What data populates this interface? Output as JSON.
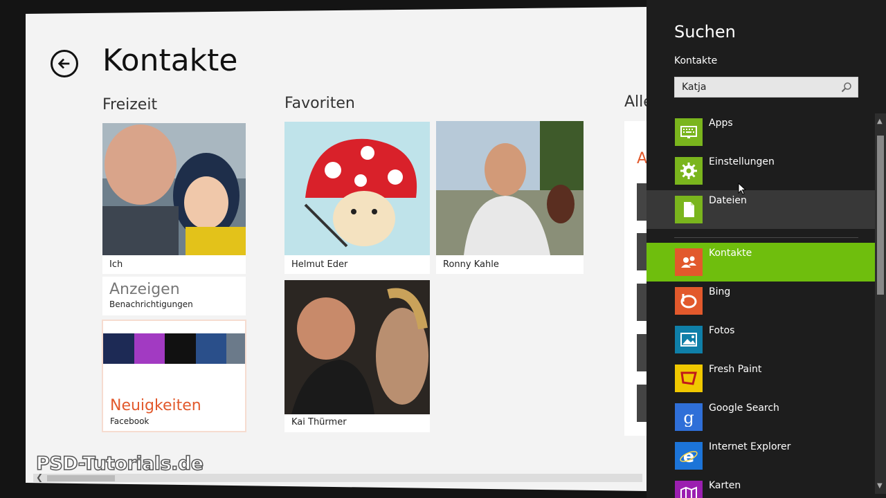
{
  "app": {
    "title": "Kontakte",
    "groups": {
      "freizeit": "Freizeit",
      "favoriten": "Favoriten",
      "alle": "Alle"
    },
    "contacts": [
      {
        "name": "Ich"
      },
      {
        "name": "Helmut Eder"
      },
      {
        "name": "Ronny Kahle"
      },
      {
        "name": "Kai Thürmer"
      }
    ],
    "notifications_tile": {
      "title": "Anzeigen",
      "subtitle": "Benachrichtigungen"
    },
    "news_tile": {
      "title": "Neuigkeiten",
      "subtitle": "Facebook"
    },
    "all_letter": "A",
    "watermark": "PSD-Tutorials.de"
  },
  "charm": {
    "title": "Suchen",
    "scope": "Kontakte",
    "query": "Katja",
    "items": [
      {
        "label": "Apps",
        "color": "#7ab51d",
        "icon": "keyboard-icon"
      },
      {
        "label": "Einstellungen",
        "color": "#7ab51d",
        "icon": "gear-icon"
      },
      {
        "label": "Dateien",
        "color": "#7ab51d",
        "icon": "file-icon"
      },
      {
        "label": "Kontakte",
        "color": "#e2592c",
        "icon": "people-icon"
      },
      {
        "label": "Bing",
        "color": "#e2592c",
        "icon": "bing-icon"
      },
      {
        "label": "Fotos",
        "color": "#0f7fa8",
        "icon": "photo-icon"
      },
      {
        "label": "Fresh Paint",
        "color": "#f0c800",
        "icon": "paint-icon"
      },
      {
        "label": "Google Search",
        "color": "#2f6fd8",
        "icon": "google-icon"
      },
      {
        "label": "Internet Explorer",
        "color": "#1c74d8",
        "icon": "ie-icon"
      },
      {
        "label": "Karten",
        "color": "#9b1fb0",
        "icon": "map-icon"
      }
    ]
  }
}
